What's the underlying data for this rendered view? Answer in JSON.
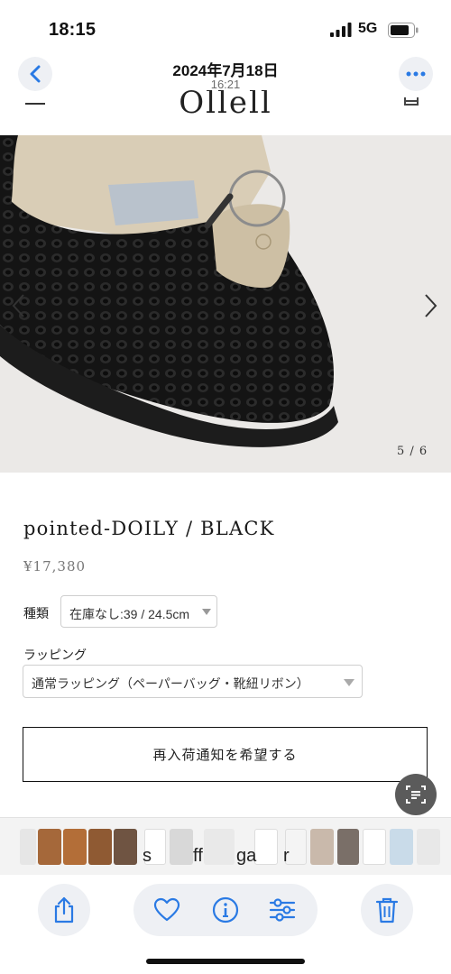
{
  "status_bar": {
    "time": "18:15",
    "network": "5G"
  },
  "nav": {
    "date": "2024年7月18日",
    "time": "16:21"
  },
  "site": {
    "logo_text": "Ollell"
  },
  "gallery": {
    "counter": "5 / 6"
  },
  "product": {
    "title": "pointed-DOILY / BLACK",
    "price": "¥17,380",
    "size_label": "種類",
    "size_value": "在庫なし:39 / 24.5cm",
    "wrapping_label": "ラッピング",
    "wrapping_value": "通常ラッピング（ペーパーバッグ・靴紐リボン）",
    "notify_button": "再入荷通知を希望する"
  },
  "thumbnail_strip": {
    "visible_text": [
      "s",
      "ff",
      "ga",
      "r"
    ]
  },
  "toolbar": {
    "buttons": [
      "share-icon",
      "heart-icon",
      "info-icon",
      "adjust-icon",
      "trash-icon"
    ]
  },
  "colors": {
    "accent": "#2a7ae4",
    "image_bg": "#ebe9e7",
    "shoe": "#171717"
  }
}
